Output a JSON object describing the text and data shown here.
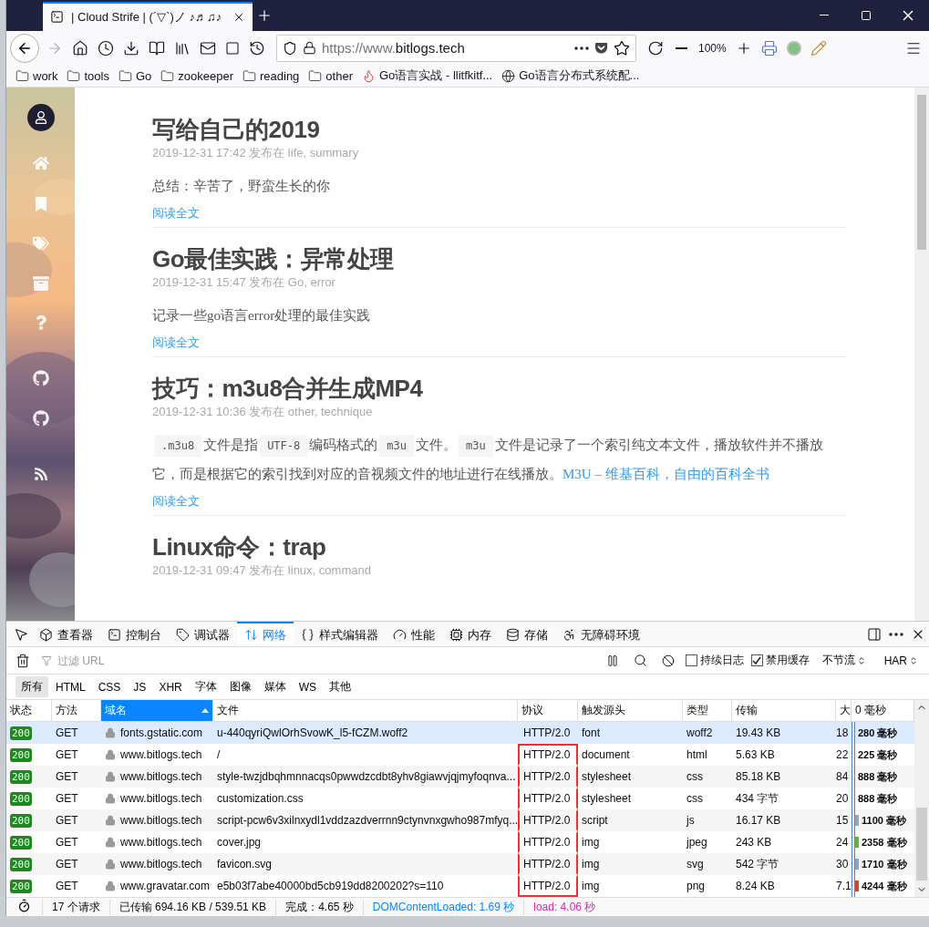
{
  "browser_tab": {
    "title": "| Cloud Strife | (´▽`)ノ ♪♬♫♪",
    "selected": true
  },
  "toolbar": {
    "url_prefix": "https://www.",
    "url_domain": "bitlogs.tech",
    "zoom": "100%",
    "forward_disabled": true
  },
  "bookmarks": [
    {
      "kind": "folder",
      "label": "work"
    },
    {
      "kind": "folder",
      "label": "tools"
    },
    {
      "kind": "folder",
      "label": "Go"
    },
    {
      "kind": "folder",
      "label": "zookeeper"
    },
    {
      "kind": "folder",
      "label": "reading"
    },
    {
      "kind": "folder",
      "label": "other"
    },
    {
      "kind": "site",
      "label": "Go语言实战 - llitfkitf..."
    },
    {
      "kind": "web",
      "label": "Go语言分布式系统配..."
    }
  ],
  "posts": [
    {
      "title": "写给自己的2019",
      "meta": "2019-12-31 17:42 发布在 life, summary",
      "body": [
        {
          "kind": "text",
          "text": "总结：辛苦了，野蛮生长的你"
        }
      ],
      "read_more": "阅读全文"
    },
    {
      "title": "Go最佳实践：异常处理",
      "meta": "2019-12-31 15:47 发布在 Go, error",
      "body": [
        {
          "kind": "text",
          "text": "记录一些go语言error处理的最佳实践"
        }
      ],
      "read_more": "阅读全文"
    },
    {
      "title": "技巧：m3u8合并生成MP4",
      "meta": "2019-12-31 10:36 发布在 other, technique",
      "body": [
        {
          "kind": "code",
          "text": ".m3u8"
        },
        {
          "kind": "text",
          "text": "文件是指"
        },
        {
          "kind": "code",
          "text": "UTF-8"
        },
        {
          "kind": "text",
          "text": "编码格式的"
        },
        {
          "kind": "code",
          "text": "m3u"
        },
        {
          "kind": "text",
          "text": "文件。"
        },
        {
          "kind": "code",
          "text": "m3u"
        },
        {
          "kind": "text",
          "text": "文件是记录了一个索引纯文本文件，播放软件并不播放它，而是根据它的索引找到对应的音视频文件的地址进行在线播放。"
        },
        {
          "kind": "link",
          "text": "M3U – 维基百科，自由的百科全书"
        }
      ],
      "read_more": "阅读全文"
    },
    {
      "title": "Linux命令：trap",
      "meta": "2019-12-31 09:47 发布在 linux, command"
    }
  ],
  "devtools": {
    "tabs": [
      {
        "kind": "inspector",
        "label": "查看器",
        "selected": false
      },
      {
        "kind": "console",
        "label": "控制台",
        "selected": false
      },
      {
        "kind": "debugger",
        "label": "调试器",
        "selected": false
      },
      {
        "kind": "network",
        "label": "网络",
        "selected": true
      },
      {
        "kind": "style",
        "label": "样式编辑器",
        "selected": false
      },
      {
        "kind": "performance",
        "label": "性能",
        "selected": false
      },
      {
        "kind": "memory",
        "label": "内存",
        "selected": false
      },
      {
        "kind": "storage",
        "label": "存储",
        "selected": false
      },
      {
        "kind": "accessibility",
        "label": "无障碍环境",
        "selected": false
      }
    ],
    "filter": {
      "placeholder": "过滤 URL"
    },
    "options": [
      {
        "label": "持续日志",
        "checked": false
      },
      {
        "label": "禁用缓存",
        "checked": true
      }
    ],
    "throttle": "不节流",
    "har": "HAR",
    "type_filters": [
      {
        "label": "所有",
        "selected": true
      },
      {
        "label": "HTML",
        "selected": false
      },
      {
        "label": "CSS",
        "selected": false
      },
      {
        "label": "JS",
        "selected": false
      },
      {
        "label": "XHR",
        "selected": false
      },
      {
        "label": "字体",
        "selected": false
      },
      {
        "label": "图像",
        "selected": false
      },
      {
        "label": "媒体",
        "selected": false
      },
      {
        "label": "WS",
        "selected": false
      },
      {
        "label": "其他",
        "selected": false
      }
    ],
    "columns": [
      {
        "label": "状态",
        "selected": false
      },
      {
        "label": "方法",
        "selected": false
      },
      {
        "label": "域名",
        "selected": true
      },
      {
        "label": "文件",
        "selected": false
      },
      {
        "label": "协议",
        "selected": false
      },
      {
        "label": "触发源头",
        "selected": false
      },
      {
        "label": "类型",
        "selected": false
      },
      {
        "label": "传输",
        "selected": false
      },
      {
        "label": "大",
        "selected": false
      },
      {
        "label": "0 毫秒",
        "selected": false
      }
    ],
    "rows": [
      {
        "status": "200",
        "method": "GET",
        "domain": "fonts.gstatic.com",
        "file": "u-440qyriQwlOrhSvowK_l5-fCZM.woff2",
        "protocol": "HTTP/2.0",
        "cause": "font",
        "type": "woff2",
        "transferred": "19.43 KB",
        "size": "18",
        "time": "280 毫秒",
        "selected": true,
        "highlighted": false
      },
      {
        "status": "200",
        "method": "GET",
        "domain": "www.bitlogs.tech",
        "file": "/",
        "protocol": "HTTP/2.0",
        "cause": "document",
        "type": "html",
        "transferred": "5.63 KB",
        "size": "22",
        "time": "225 毫秒",
        "selected": false,
        "highlighted": true
      },
      {
        "status": "200",
        "method": "GET",
        "domain": "www.bitlogs.tech",
        "file": "style-twzjdbqhmnnacqs0pwwdzcdbt8yhv8giawvjqjmyfoqnva...",
        "protocol": "HTTP/2.0",
        "cause": "stylesheet",
        "type": "css",
        "transferred": "85.18 KB",
        "size": "84",
        "time": "888 毫秒",
        "selected": false,
        "highlighted": true
      },
      {
        "status": "200",
        "method": "GET",
        "domain": "www.bitlogs.tech",
        "file": "customization.css",
        "protocol": "HTTP/2.0",
        "cause": "stylesheet",
        "type": "css",
        "transferred": "434 字节",
        "size": "20",
        "time": "888 毫秒",
        "selected": false,
        "highlighted": true
      },
      {
        "status": "200",
        "method": "GET",
        "domain": "www.bitlogs.tech",
        "file": "script-pcw6v3xilnxydl1vddzazdverrnn9ctynvnxgwho987mfyq...",
        "protocol": "HTTP/2.0",
        "cause": "script",
        "type": "js",
        "transferred": "16.17 KB",
        "size": "15",
        "time": "1100 毫秒",
        "selected": false,
        "highlighted": true,
        "color": "#9aa4b8"
      },
      {
        "status": "200",
        "method": "GET",
        "domain": "www.bitlogs.tech",
        "file": "cover.jpg",
        "protocol": "HTTP/2.0",
        "cause": "img",
        "type": "jpeg",
        "transferred": "243 KB",
        "size": "24",
        "time": "2358 毫秒",
        "selected": false,
        "highlighted": true,
        "color": "#5cb82e"
      },
      {
        "status": "200",
        "method": "GET",
        "domain": "www.bitlogs.tech",
        "file": "favicon.svg",
        "protocol": "HTTP/2.0",
        "cause": "img",
        "type": "svg",
        "transferred": "542 字节",
        "size": "30",
        "time": "1710 毫秒",
        "selected": false,
        "highlighted": true,
        "color": "#8e9fc8"
      },
      {
        "status": "200",
        "method": "GET",
        "domain": "www.gravatar.com",
        "file": "e5b03f7abe40000bd5cb919dd8200202?s=110",
        "protocol": "HTTP/2.0",
        "cause": "img",
        "type": "png",
        "transferred": "8.24 KB",
        "size": "7.1",
        "time": "4244 毫秒",
        "selected": false,
        "highlighted": true,
        "color": "#d2482a"
      }
    ],
    "summary": {
      "requests": "17 个请求",
      "transferred": "已传输 694.16 KB / 539.51 KB",
      "finish": "完成：4.65 秒",
      "dom": "DOMContentLoaded: 1.69 秒",
      "load": "load: 4.06 秒"
    }
  }
}
